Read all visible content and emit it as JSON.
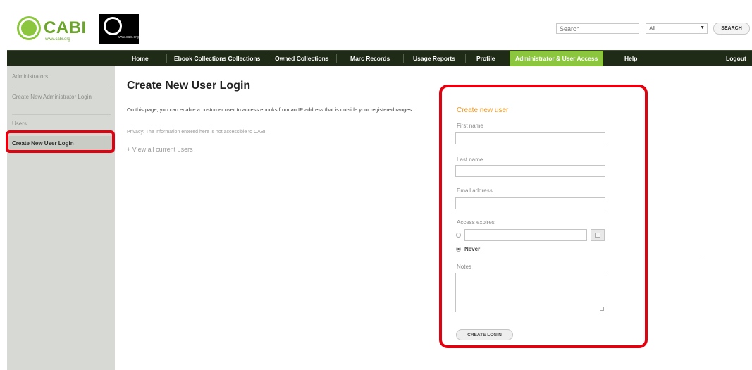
{
  "header": {
    "logo_text": "CABI",
    "logo_sub": "www.cabi.org",
    "logo_black_sub": "www.cabi.org",
    "search_placeholder": "Search",
    "search_scope": "All",
    "search_button": "SEARCH"
  },
  "nav": {
    "items": [
      {
        "label": "Home"
      },
      {
        "label": "Ebook Collections Collections"
      },
      {
        "label": "Owned Collections"
      },
      {
        "label": "Marc Records"
      },
      {
        "label": "Usage Reports"
      },
      {
        "label": "Profile"
      },
      {
        "label": "Administrator & User Access"
      },
      {
        "label": "Help"
      },
      {
        "label": "Logout"
      }
    ],
    "active_index": 6
  },
  "sidebar": {
    "items": [
      {
        "label": "Administrators"
      },
      {
        "label": "Create New Administrator Login"
      },
      {
        "label": "Users"
      },
      {
        "label": "Create New User Login"
      }
    ],
    "active_index": 3
  },
  "main": {
    "title": "Create New User Login",
    "description": "On this page, you can enable a customer user to access ebooks from an IP address that is outside your registered ranges.",
    "privacy": "Privacy: The information entered here is not accessible to CABI.",
    "view_link": "+ View all current users"
  },
  "form": {
    "heading": "Create new user",
    "first_name_label": "First name",
    "last_name_label": "Last name",
    "email_label": "Email address",
    "access_label": "Access expires",
    "never_label": "Never",
    "notes_label": "Notes",
    "submit_label": "CREATE LOGIN"
  },
  "colors": {
    "nav_bg": "#1f2a17",
    "nav_active": "#8cc63f",
    "sidebar_bg": "#d7d9d4",
    "highlight": "#e3000f",
    "form_heading": "#f09a22",
    "brand_green": "#6ba52c"
  }
}
